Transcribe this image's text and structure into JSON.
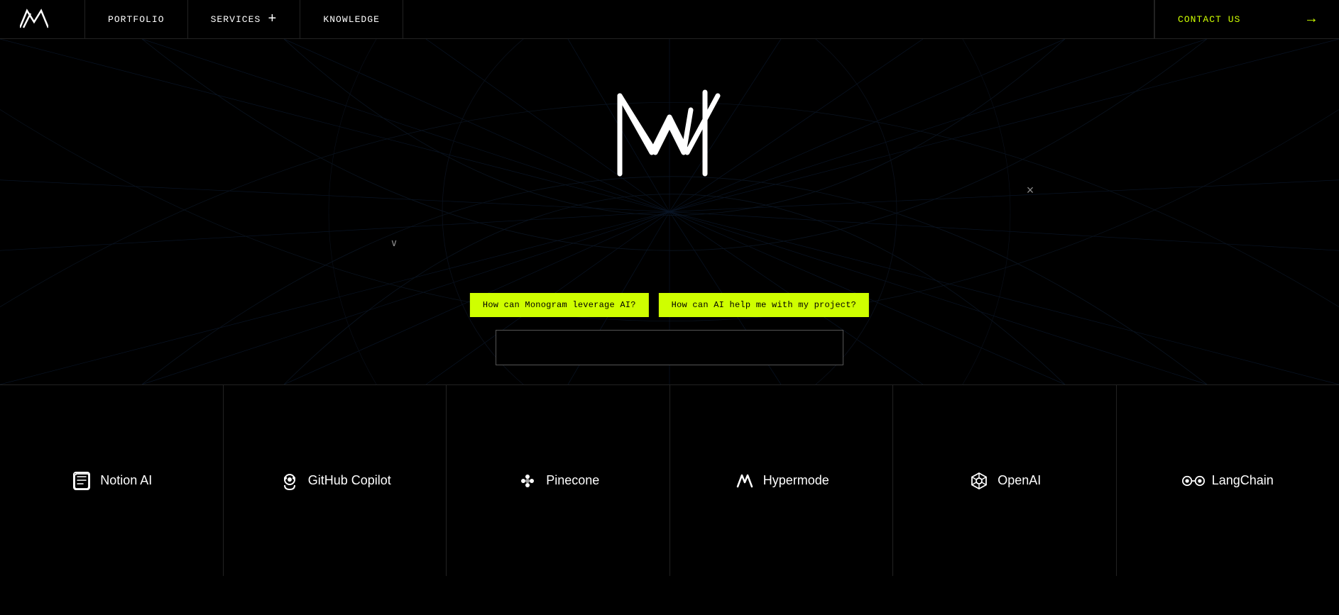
{
  "nav": {
    "logo_label": "Monogram logo",
    "portfolio_label": "PORTFOLIO",
    "services_label": "SERVICES",
    "services_plus": "+",
    "knowledge_label": "KNOWLEDGE",
    "contact_label": "CONTACT US",
    "contact_arrow": "→"
  },
  "hero": {
    "close_label": "×",
    "chevron_label": "∨",
    "chip1": "How can Monogram leverage AI?",
    "chip2": "How can AI help me with my project?",
    "search_placeholder": ""
  },
  "brands": [
    {
      "icon": "notion",
      "label": "Notion AI"
    },
    {
      "icon": "github",
      "label": "GitHub Copilot"
    },
    {
      "icon": "pinecone",
      "label": "Pinecone"
    },
    {
      "icon": "hypermode",
      "label": "Hypermode"
    },
    {
      "icon": "openai",
      "label": "OpenAI"
    },
    {
      "icon": "langchain",
      "label": "LangChain"
    }
  ]
}
